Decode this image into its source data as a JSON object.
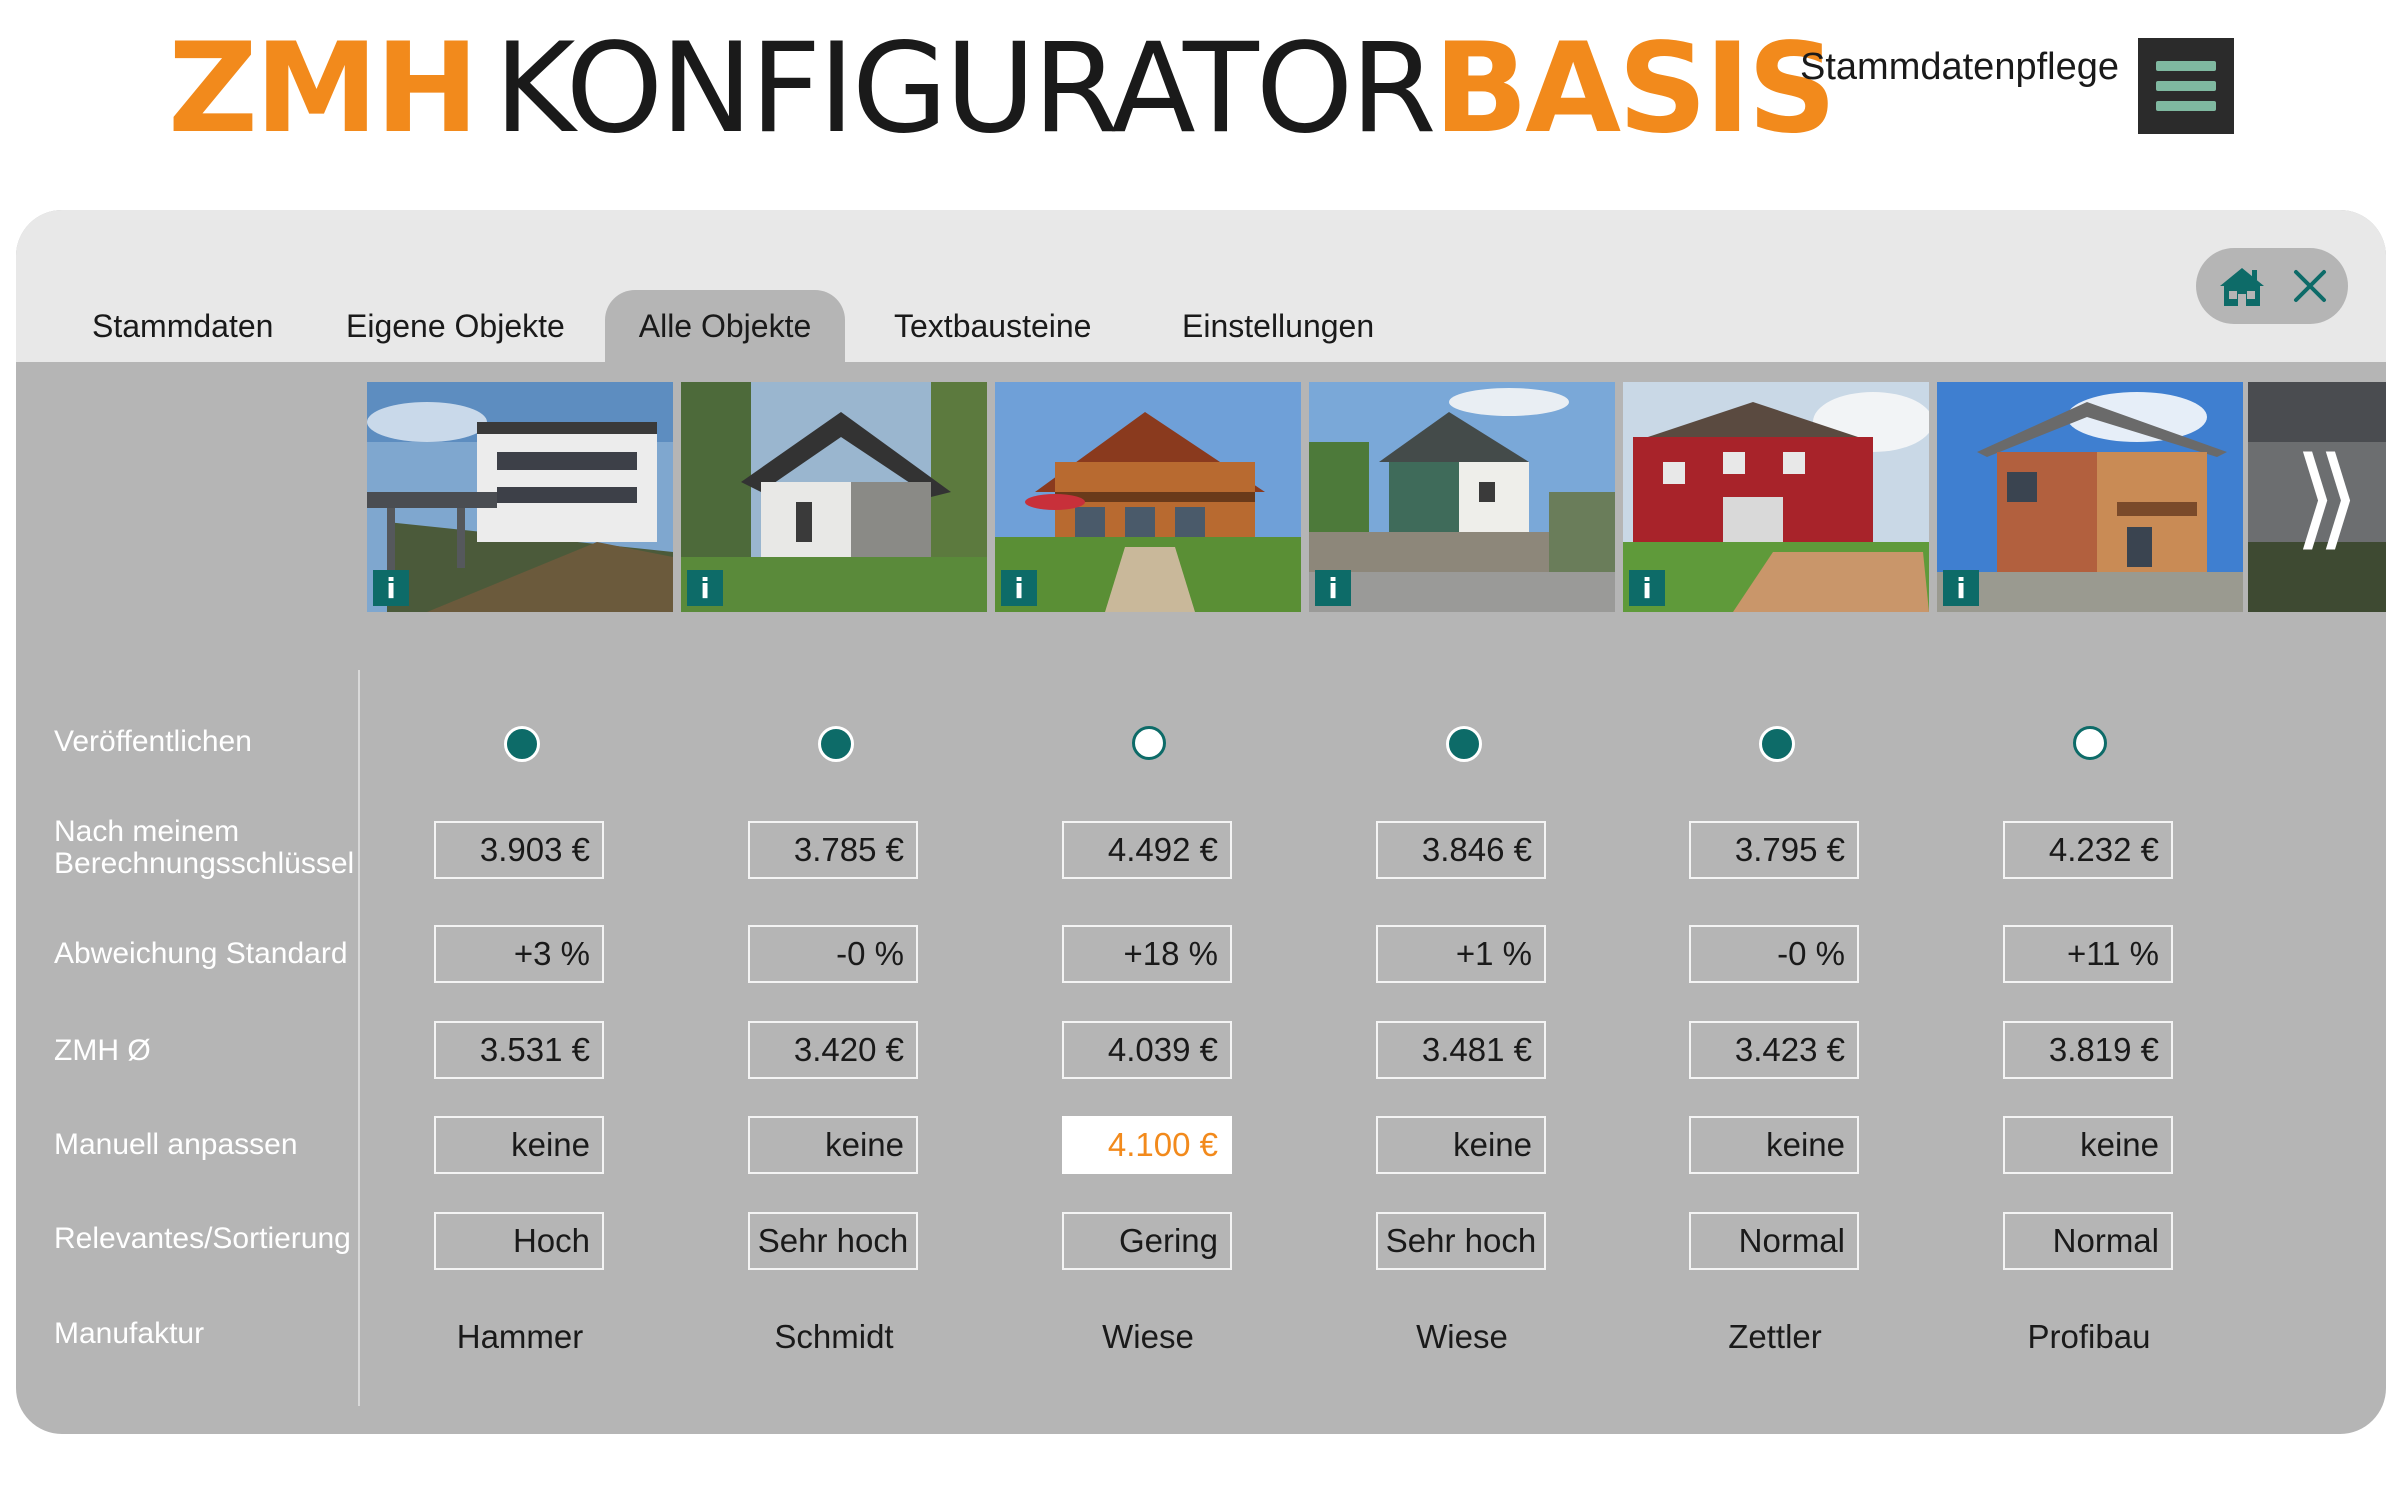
{
  "header": {
    "logo_zmh": "ZMH",
    "logo_konfigurator": "KONFIGURATOR",
    "logo_basis": "BASIS",
    "stammdaten_link": "Stammdatenpflege",
    "menu_icon": "hamburger-menu-icon"
  },
  "colors": {
    "accent_orange": "#f28a1c",
    "teal": "#0d6b68",
    "panel_gray": "#b5b5b5",
    "tabbar_gray": "#e8e8e8"
  },
  "tabs": [
    {
      "label": "Stammdaten",
      "active": false
    },
    {
      "label": "Eigene Objekte",
      "active": false
    },
    {
      "label": "Alle Objekte",
      "active": true
    },
    {
      "label": "Textbausteine",
      "active": false
    },
    {
      "label": "Einstellungen",
      "active": false
    }
  ],
  "top_right_icons": [
    "home-icon",
    "close-icon"
  ],
  "thumbnail_info_label": "i",
  "next_arrow": "⟩⟩",
  "row_labels": {
    "publish": "Veröffentlichen",
    "calc_key_line1": "Nach meinem",
    "calc_key_line2": "Berechnungsschlüssel",
    "deviation": "Abweichung Standard",
    "zmh_avg": "ZMH Ø",
    "manual": "Manuell anpassen",
    "relevance": "Relevantes/Sortierung",
    "manufacturer": "Manufaktur"
  },
  "objects": [
    {
      "published": true,
      "calc": "3.903 €",
      "deviation": "+3 %",
      "zmh_avg": "3.531 €",
      "manual": "keine",
      "relevance": "Hoch",
      "manufacturer": "Hammer"
    },
    {
      "published": true,
      "calc": "3.785 €",
      "deviation": "-0 %",
      "zmh_avg": "3.420 €",
      "manual": "keine",
      "relevance": "Sehr hoch",
      "manufacturer": "Schmidt"
    },
    {
      "published": false,
      "calc": "4.492 €",
      "deviation": "+18 %",
      "zmh_avg": "4.039 €",
      "manual": "4.100 €",
      "relevance": "Gering",
      "manufacturer": "Wiese"
    },
    {
      "published": true,
      "calc": "3.846 €",
      "deviation": "+1 %",
      "zmh_avg": "3.481 €",
      "manual": "keine",
      "relevance": "Sehr hoch",
      "manufacturer": "Wiese"
    },
    {
      "published": true,
      "calc": "3.795 €",
      "deviation": "-0 %",
      "zmh_avg": "3.423 €",
      "manual": "keine",
      "relevance": "Normal",
      "manufacturer": "Zettler"
    },
    {
      "published": false,
      "calc": "4.232 €",
      "deviation": "+11 %",
      "zmh_avg": "3.819 €",
      "manual": "keine",
      "relevance": "Normal",
      "manufacturer": "Profibau"
    }
  ]
}
